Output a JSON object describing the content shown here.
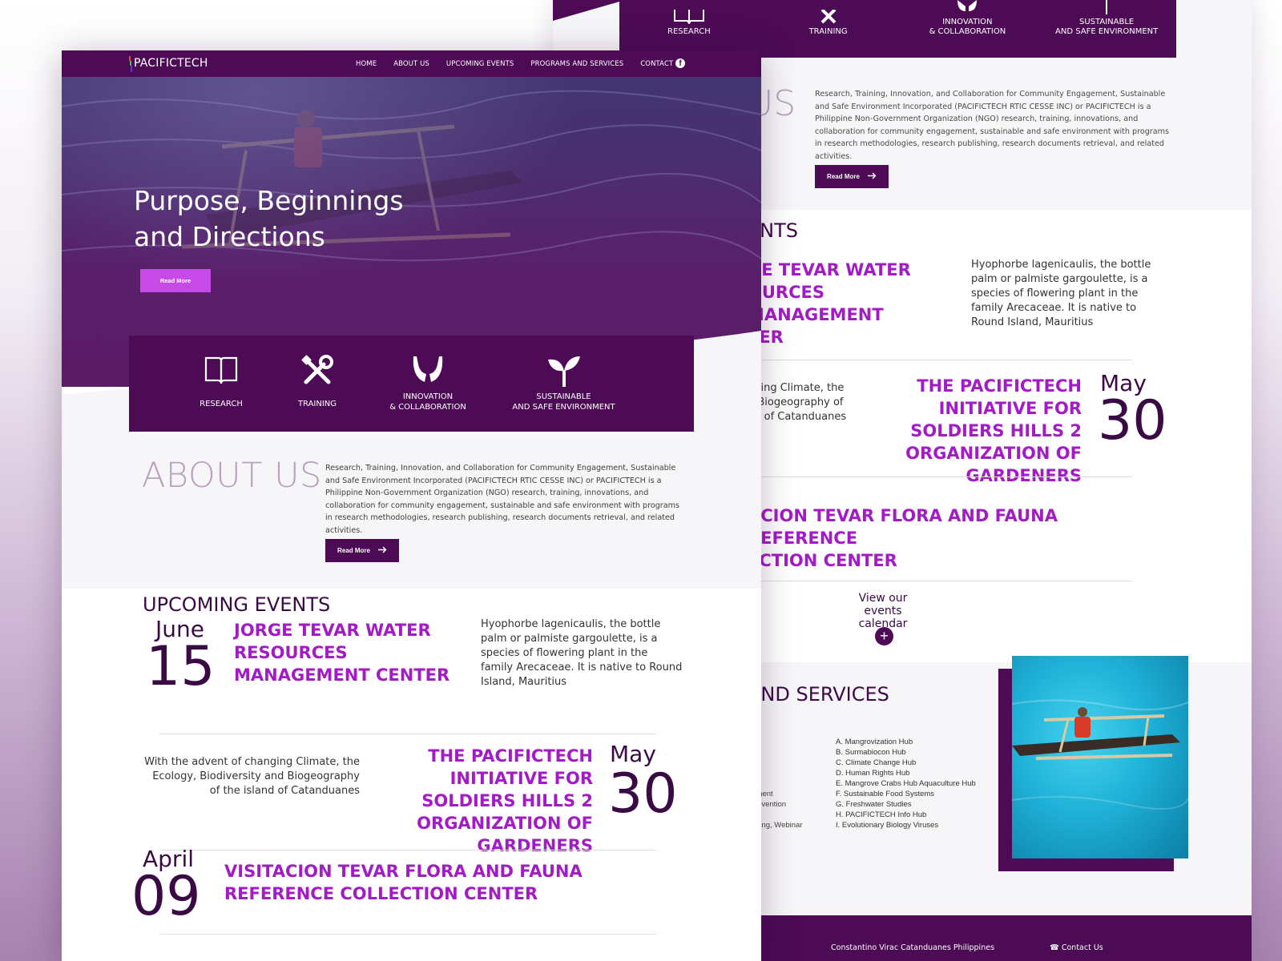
{
  "colors": {
    "brand_purple": "#4d0b56",
    "accent_magenta": "#a31bc6",
    "button_pink": "#c64be6",
    "about_heading": "#b8a1be"
  },
  "nav": {
    "logo": "PACIFICTECH",
    "links": [
      "HOME",
      "ABOUT US",
      "UPCOMING EVENTS",
      "PROGRAMS AND SERVICES",
      "CONTACT US"
    ],
    "social_icon": "facebook-icon"
  },
  "hero": {
    "title": "Purpose, Beginnings and Directions",
    "button": "Read More"
  },
  "features": [
    {
      "label": "RESEARCH",
      "icon": "open-book-icon"
    },
    {
      "label": "TRAINING",
      "icon": "tools-icon"
    },
    {
      "label": "INNOVATION\n& COLLABORATION",
      "icon": "hands-icon"
    },
    {
      "label": "SUSTAINABLE\nAND SAFE ENVIRONMENT",
      "icon": "sprout-icon"
    }
  ],
  "about": {
    "title": "ABOUT US",
    "text": "Research, Training, Innovation, and Collaboration for Community Engagement, Sustainable and Safe Environment Incorporated (PACIFICTECH RTIC CESSE INC) or PACIFICTECH is a Philippine Non-Government Organization (NGO) research, training, innovations, and collaboration for community engagement, sustainable and safe environment with programs in research methodologies, research publishing, research documents retrieval, and related activities.",
    "button": "Read More"
  },
  "events": {
    "title": "UPCOMING EVENTS",
    "items": [
      {
        "month": "June",
        "day": "15",
        "title": "JORGE TEVAR WATER RESOURCES MANAGEMENT CENTER",
        "desc": "Hyophorbe lagenicaulis, the bottle palm or palmiste gargoulette, is a species of flowering plant in the family Arecaceae. It is native to Round Island, Mauritius"
      },
      {
        "month": "May",
        "day": "30",
        "title": "THE PACIFICTECH INITIATIVE FOR SOLDIERS HILLS 2 ORGANIZATION OF GARDENERS",
        "desc": "With the advent of changing Climate, the Ecology, Biodiversity and Biogeography of the island of Catanduanes"
      },
      {
        "month": "April",
        "day": "09",
        "title": "VISITACION TEVAR FLORA AND FAUNA REFERENCE COLLECTION CENTER",
        "desc": ""
      }
    ]
  },
  "back": {
    "features": [
      "RESEARCH",
      "TRAINING",
      "INNOVATION\n& COLLABORATION",
      "SUSTAINABLE\nAND SAFE ENVIRONMENT"
    ],
    "about_fragment": "US",
    "about_text": "Research, Training, Innovation, and Collaboration for Community Engagement, Sustainable and Safe Environment Incorporated (PACIFICTECH RTIC CESSE INC) or PACIFICTECH is a Philippine Non-Government Organization (NGO) research, training, innovations, and collaboration for community engagement, sustainable and safe environment with programs in research methodologies, research publishing, research documents retrieval, and related activities.",
    "read_more": "Read More",
    "events_fragment": "ENTS",
    "ev1_title": "GE TEVAR WATER\nOURCES MANAGEMENT\nTER",
    "ev1_desc": "Hyophorbe lagenicaulis, the bottle palm or palmiste gargoulette, is a species of flowering plant in the family Arecaceae. It is native to Round Island, Mauritius",
    "ev2_desc": "nging Climate, the\nd Biogeography of\nnd of Catanduanes",
    "ev2_title": "THE PACIFICTECH INITIATIVE FOR SOLDIERS HILLS 2 ORGANIZATION OF GARDENERS",
    "ev2_month": "May",
    "ev2_day": "30",
    "ev3_title": "ACION TEVAR FLORA AND FAUNA REFERENCE\nECTION CENTER",
    "view_calendar": "View our events calendar",
    "services_fragment": "AND SERVICES",
    "left_list": [
      "onment",
      "Convention",
      "",
      "encing, Webinar"
    ],
    "services_list": [
      "A. Mangrovization Hub",
      "B. Surmabiocon Hub",
      "C. Climate Change Hub",
      "D. Human Rights Hub",
      "E. Mangrove Crabs Hub Aquaculture Hub",
      "F. Sustainable Food Systems",
      "G. Freshwater Studies",
      "H. PACIFICTECH Info Hub",
      "I. Evolutionary Biology Viruses"
    ],
    "footer_address": "Constantino Virac Catanduanes Philippines",
    "footer_contact": "Contact  Us"
  }
}
